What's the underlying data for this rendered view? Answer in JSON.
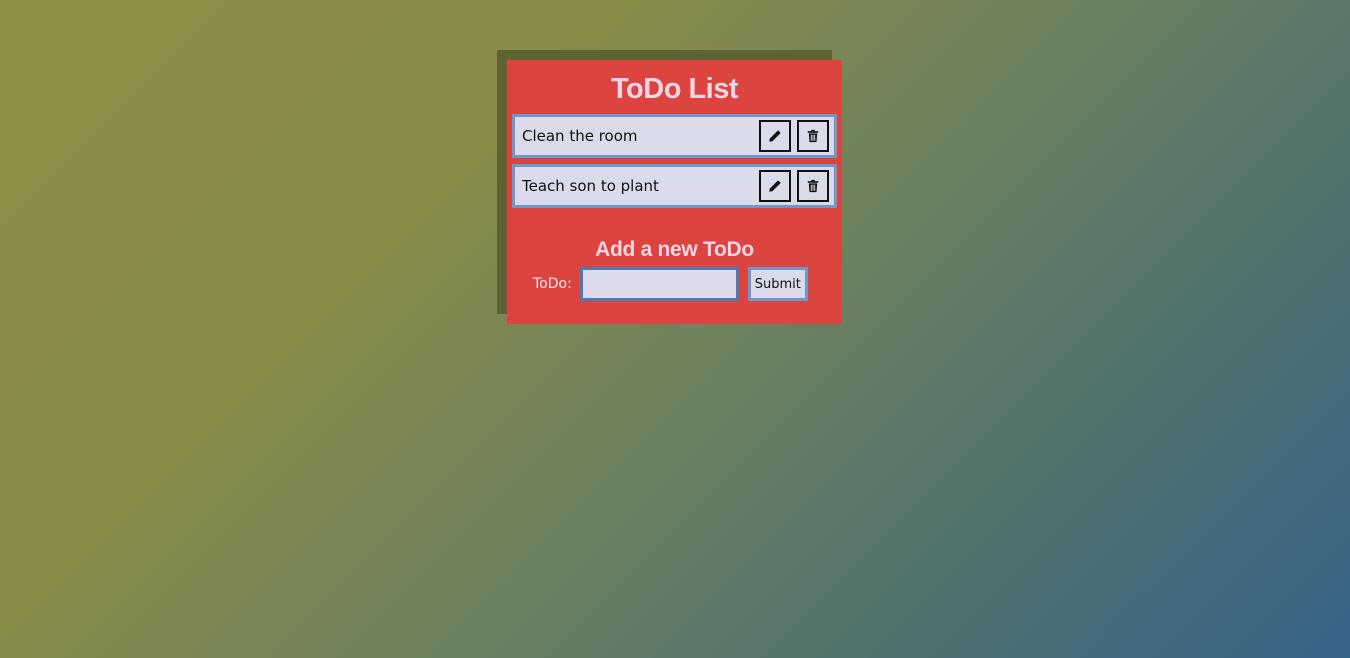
{
  "app": {
    "title": "ToDo List"
  },
  "todos": [
    {
      "text": "Clean the room",
      "edit_icon": "pencil-icon",
      "delete_icon": "trash-icon"
    },
    {
      "text": "Teach son to plant",
      "edit_icon": "pencil-icon",
      "delete_icon": "trash-icon"
    }
  ],
  "form": {
    "title": "Add a new ToDo",
    "label": "ToDo:",
    "input_value": "",
    "submit_label": "Submit"
  },
  "colors": {
    "card": "#dc4440",
    "card_shadow": "#5d6332",
    "item_background": "#dadaea",
    "item_border": "#6d98c9",
    "heading_text": "#f3d6e4"
  }
}
